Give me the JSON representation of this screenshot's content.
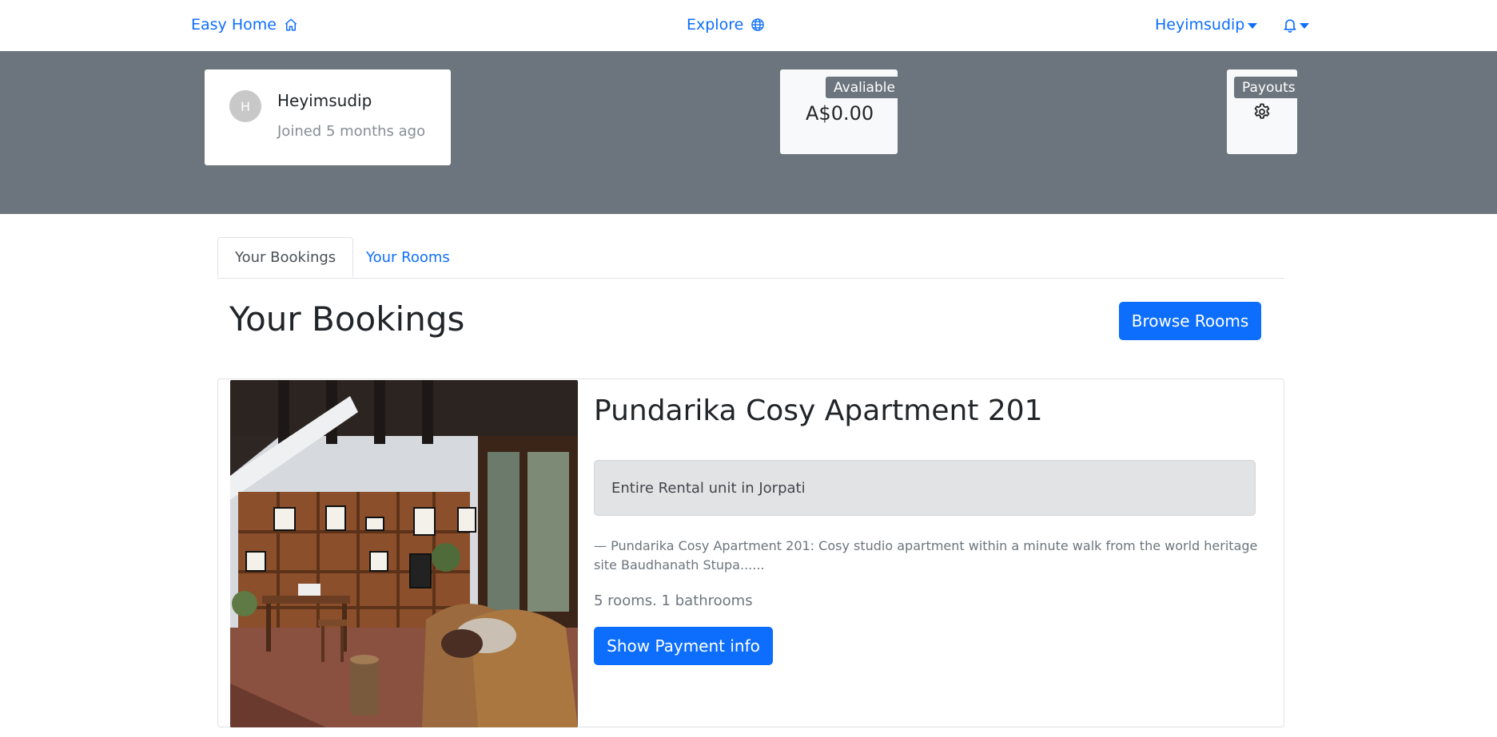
{
  "nav": {
    "brand_label": "Easy Home",
    "brand_icon": "house-icon",
    "explore_label": "Explore",
    "explore_icon": "globe-icon",
    "user_label": "Heyimsudip",
    "notifications_icon": "bell-icon"
  },
  "profile": {
    "avatar_initial": "H",
    "name": "Heyimsudip",
    "joined": "Joined 5 months ago"
  },
  "balance": {
    "badge": "Avaliable",
    "amount": "A$0.00"
  },
  "payouts": {
    "badge": "Payouts",
    "icon": "gear-icon"
  },
  "tabs": [
    {
      "label": "Your Bookings",
      "active": true
    },
    {
      "label": "Your Rooms",
      "active": false
    }
  ],
  "main": {
    "title": "Your Bookings",
    "browse_button": "Browse Rooms"
  },
  "bookings": [
    {
      "title": "Pundarika Cosy Apartment 201",
      "type": "Entire Rental unit in Jorpati",
      "description": "— Pundarika Cosy Apartment 201: Cosy studio apartment within a minute walk from the world heritage site Baudhanath Stupa......",
      "specs": "5 rooms. 1 bathrooms",
      "payment_button": "Show Payment info"
    }
  ],
  "colors": {
    "primary": "#0d6efd",
    "hero_bg": "#6c757d",
    "badge_bg": "#6c757d",
    "room_type_bg": "#e2e3e5"
  }
}
